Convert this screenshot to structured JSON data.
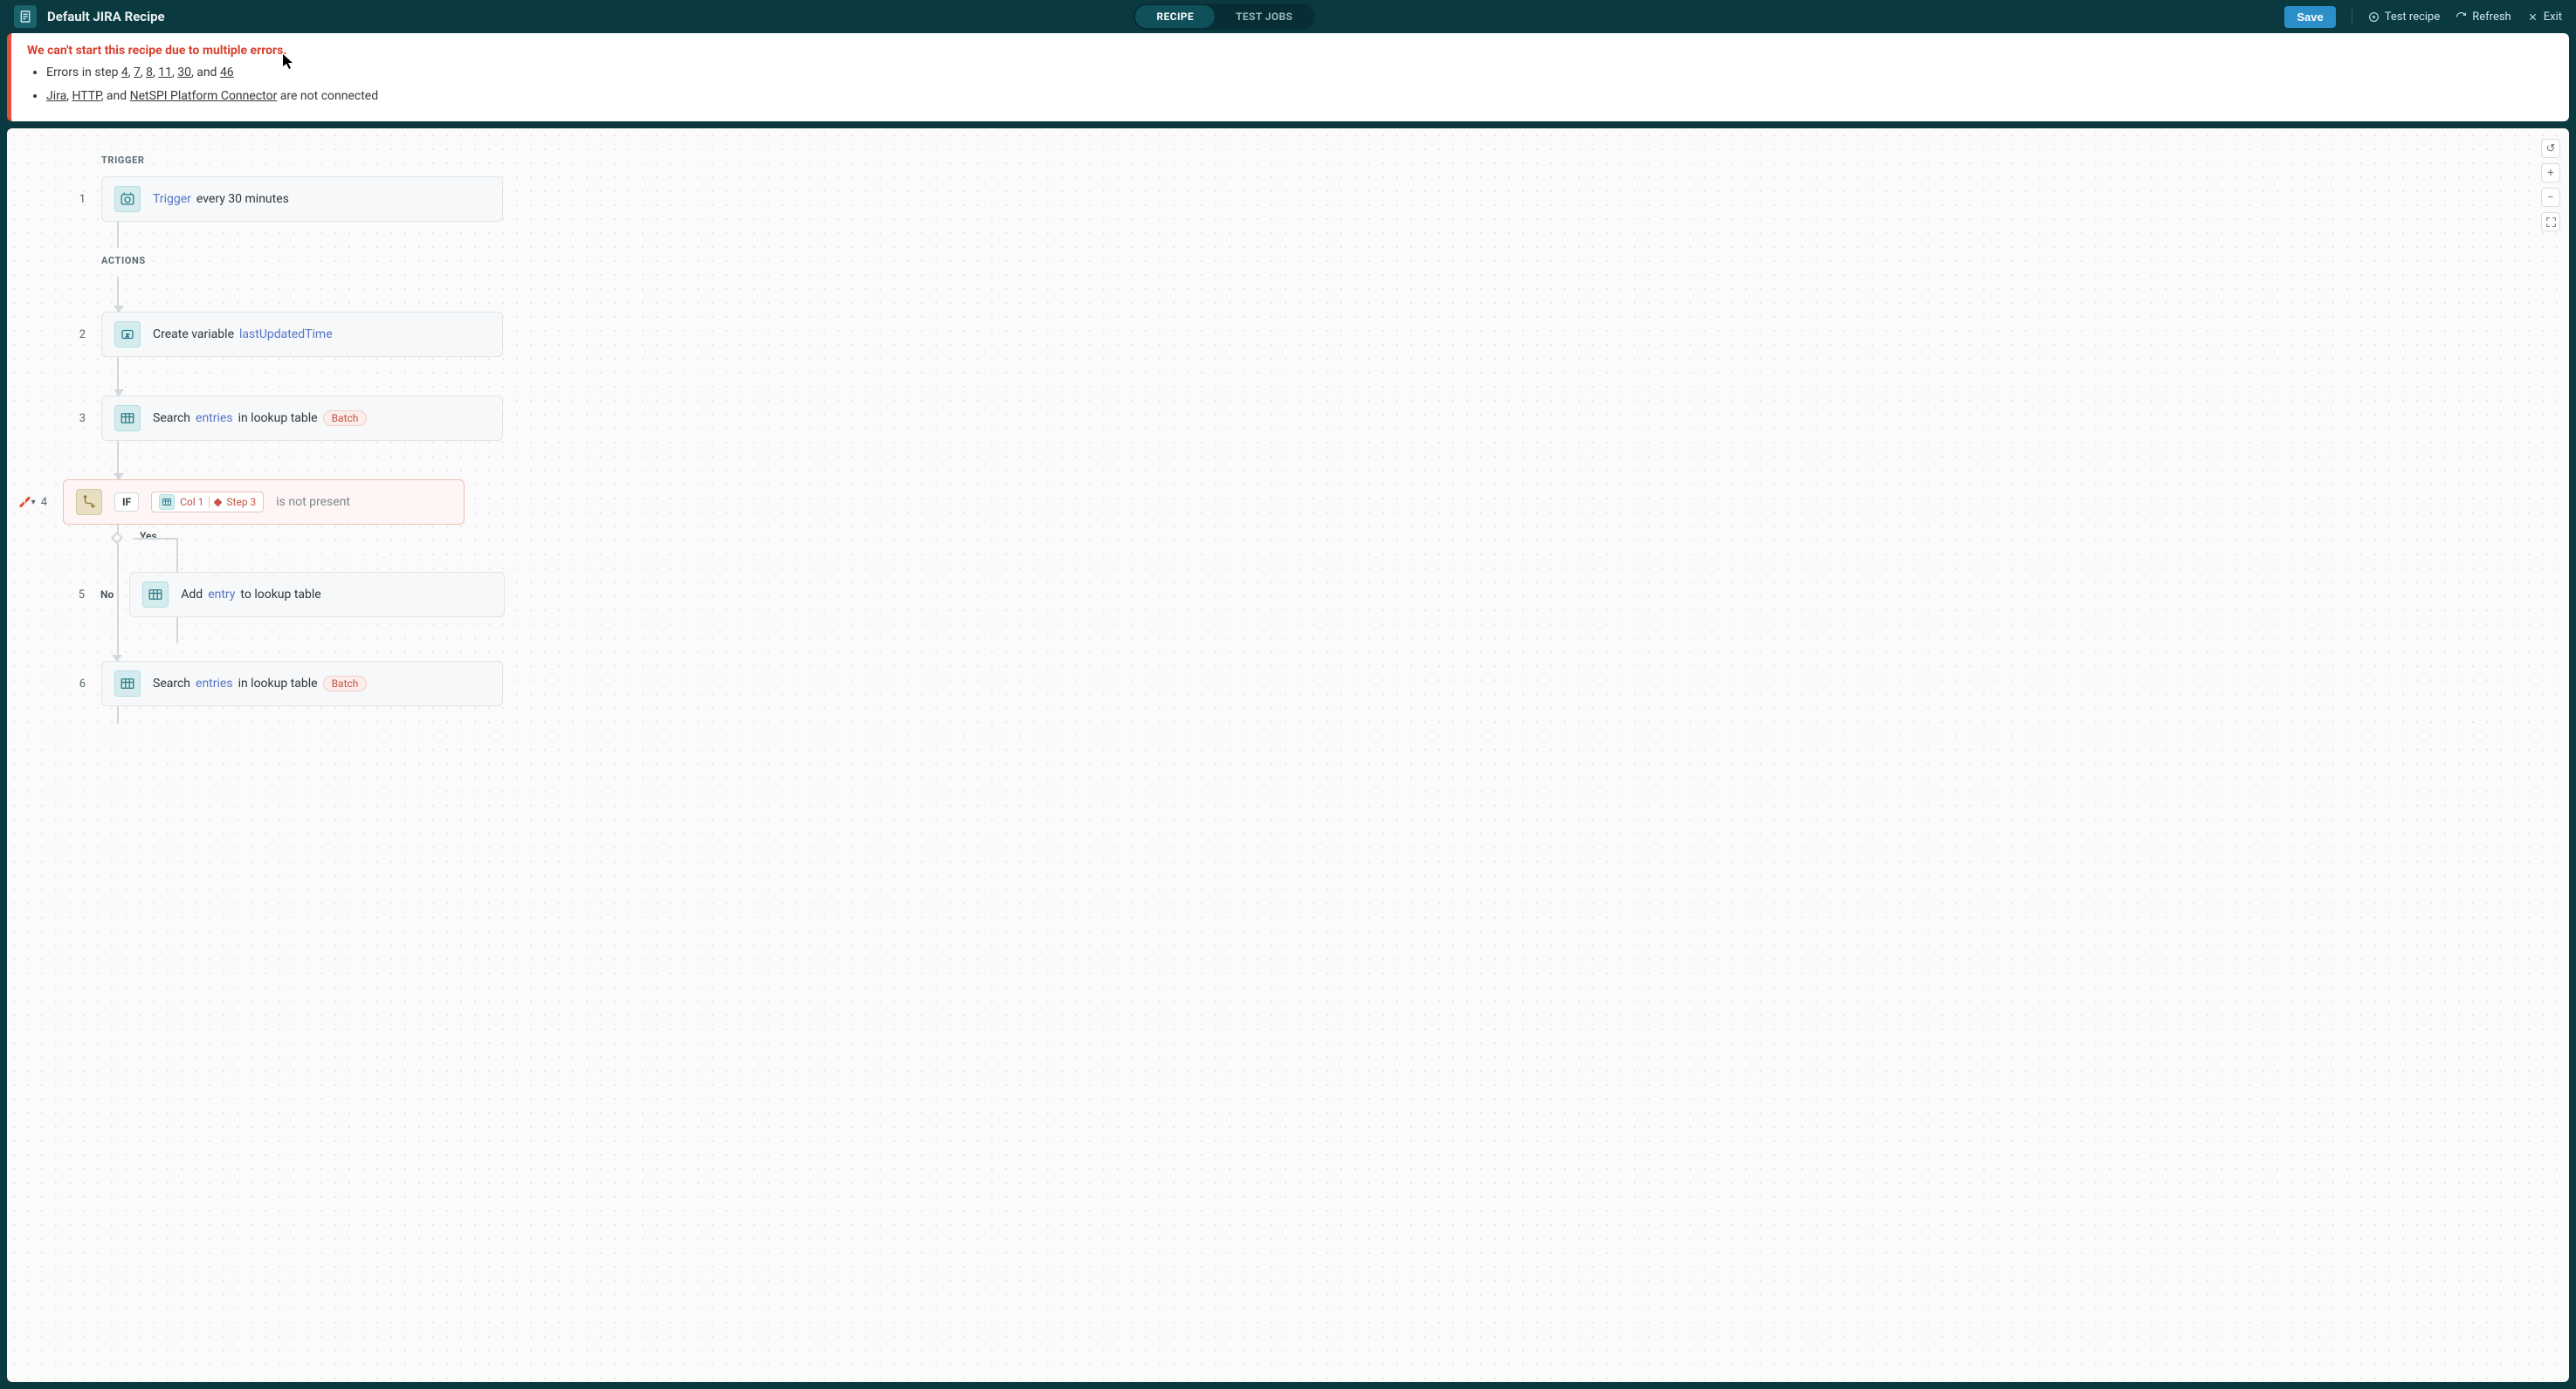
{
  "header": {
    "title": "Default JIRA Recipe",
    "tabs": {
      "recipe": "RECIPE",
      "testjobs": "TEST JOBS"
    },
    "actions": {
      "save": "Save",
      "test": "Test recipe",
      "refresh": "Refresh",
      "exit": "Exit"
    }
  },
  "error_banner": {
    "title": "We can't start this recipe due to multiple errors.",
    "errors_prefix": "Errors in step ",
    "error_steps": [
      "4",
      "7",
      "8",
      "11",
      "30",
      "46"
    ],
    "errors_joiner_and": ", and ",
    "conn_prefix_sep": ", ",
    "conn_and": ", and ",
    "connections": [
      "Jira",
      "HTTP",
      "NetSPI Platform Connector"
    ],
    "conn_suffix": " are not connected"
  },
  "sections": {
    "trigger": "TRIGGER",
    "actions": "ACTIONS"
  },
  "trigger": {
    "num": "1",
    "label_prefix": "Trigger",
    "label_suffix": " every 30 minutes"
  },
  "steps": {
    "s2": {
      "num": "2",
      "prefix": "Create variable ",
      "var": "lastUpdatedTime"
    },
    "s3": {
      "num": "3",
      "prefix": "Search ",
      "link": "entries",
      "suffix": " in lookup table",
      "badge": "Batch"
    },
    "s4": {
      "num": "4",
      "if_label": "IF",
      "pill_col": "Col 1",
      "pill_step": "Step 3",
      "condition": "is not present",
      "yes_label": "Yes",
      "no_label": "No"
    },
    "s5": {
      "num": "5",
      "prefix": "Add ",
      "link": "entry",
      "suffix": " to lookup table"
    },
    "s6": {
      "num": "6",
      "prefix": "Search ",
      "link": "entries",
      "suffix": " in lookup table",
      "badge": "Batch"
    }
  },
  "right_tools": {
    "reset": "↺",
    "plus": "+",
    "minus": "−",
    "fit": "⛶"
  }
}
